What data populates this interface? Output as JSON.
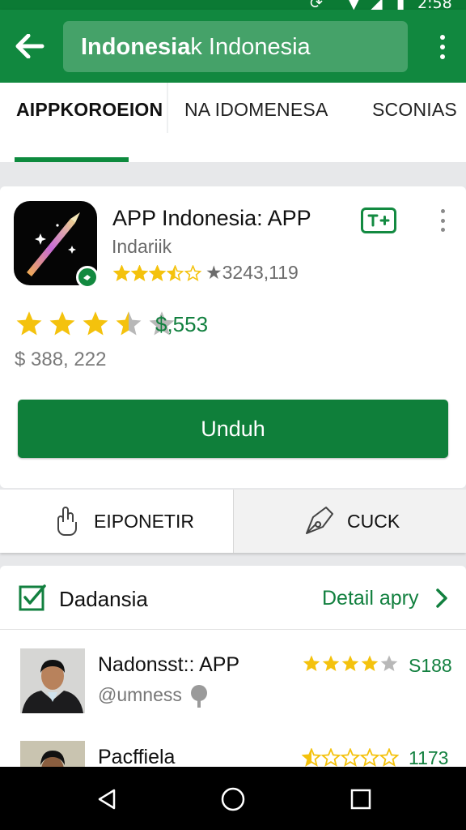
{
  "status_bar": {
    "time": "2:58"
  },
  "appbar": {
    "search_bold": "Indonesia",
    "search_rest": "k Indonesia"
  },
  "tabs": [
    {
      "label": "AIPPKOROEION",
      "active": true
    },
    {
      "label": "NA IDOMENESA",
      "active": false
    },
    {
      "label": "SCONIAS",
      "active": false
    }
  ],
  "app": {
    "title": "APP Indonesia: APP",
    "developer": "Indariik",
    "small_rating": 3.5,
    "rating_count": "★3243,119",
    "big_rating": 3.5,
    "price": "$,553",
    "sub_price": "$ 388, 222",
    "install_label": "Unduh"
  },
  "actions": {
    "left_label": "EIPONETIR",
    "right_label": "CUCK"
  },
  "list": {
    "title": "Dadansia",
    "detail_link": "Detail apry",
    "rows": [
      {
        "name": "Nadonsst:: APP",
        "handle": "@umness",
        "rating": 4,
        "count": "S188"
      },
      {
        "name": "Pacffiela",
        "handle": "",
        "rating": 0.5,
        "count": "1173"
      }
    ]
  },
  "icons": {
    "back": "back-arrow-icon",
    "menu": "more-vertical-icon",
    "install_mini": "add-to-library-icon",
    "share": "hand-pointer-icon",
    "cuck": "pen-nib-icon",
    "check": "checkbox-icon",
    "chevron": "chevron-right-icon",
    "nav_back": "triangle-back-icon",
    "nav_home": "circle-home-icon",
    "nav_recent": "square-recents-icon"
  },
  "colors": {
    "brand_green": "#11883f",
    "star": "#f4c20d",
    "star_empty": "#b8b8b8",
    "link_green": "#12803f"
  }
}
